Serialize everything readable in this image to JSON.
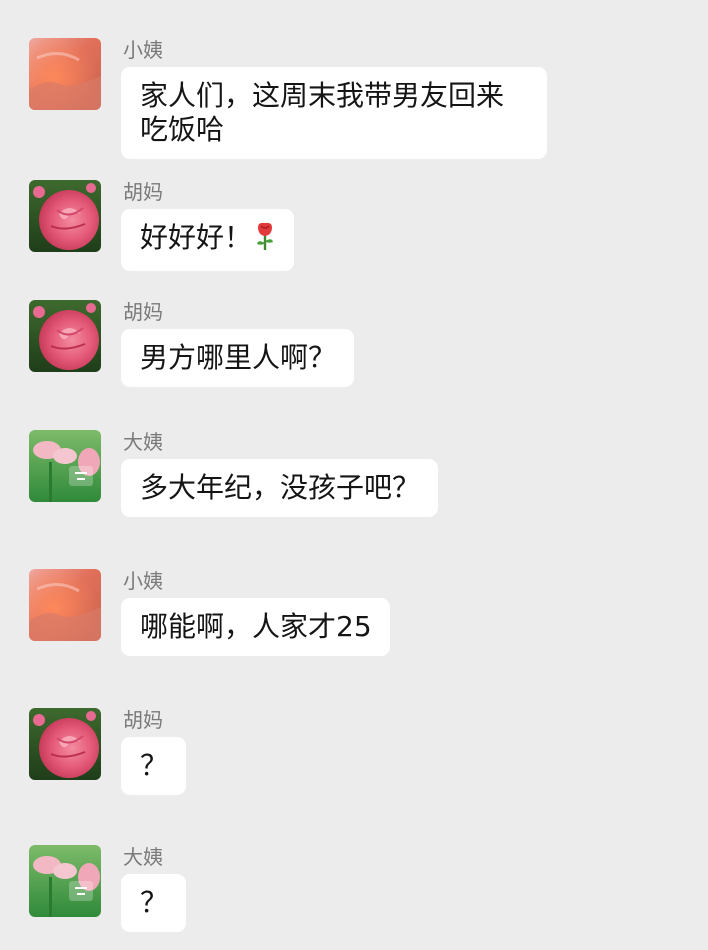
{
  "senders": {
    "xiaoyi": "小姨",
    "huma": "胡妈",
    "dayi": "大姨"
  },
  "messages": [
    {
      "sender": "小姨",
      "text": "家人们，这周末我带男友回来吃饭哈",
      "avatar": "sunset-avatar"
    },
    {
      "sender": "胡妈",
      "text": "好好好！",
      "emoji": "rose-icon",
      "avatar": "pink-rose-avatar"
    },
    {
      "sender": "胡妈",
      "text": "男方哪里人啊？",
      "avatar": "pink-rose-avatar"
    },
    {
      "sender": "大姨",
      "text": "多大年纪，没孩子吧？",
      "avatar": "lotus-avatar"
    },
    {
      "sender": "小姨",
      "text": "哪能啊，人家才25",
      "avatar": "sunset-avatar"
    },
    {
      "sender": "胡妈",
      "text": "？",
      "avatar": "pink-rose-avatar"
    },
    {
      "sender": "大姨",
      "text": "？",
      "avatar": "lotus-avatar"
    }
  ],
  "colors": {
    "background": "#ececec",
    "bubble": "#ffffff",
    "sender_name": "#7a7a7a",
    "message_text": "#151515"
  }
}
